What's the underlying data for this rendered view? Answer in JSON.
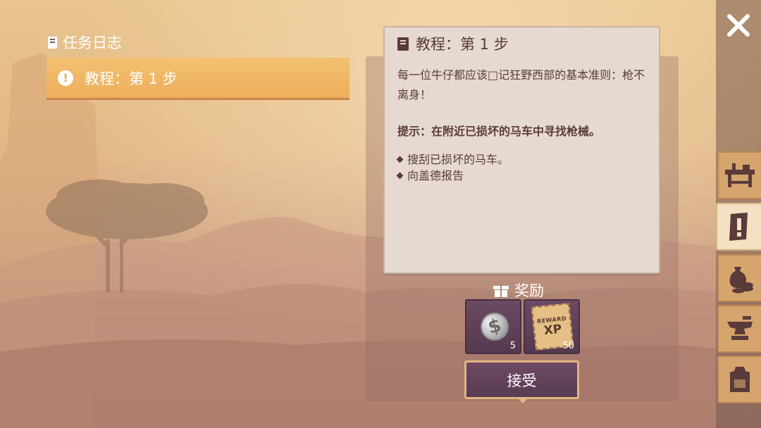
{
  "quest_log": {
    "title": "任务日志",
    "items": [
      {
        "label": "教程：第 1 步",
        "selected": true
      }
    ]
  },
  "detail": {
    "title": "教程：第 1 步",
    "description": "每一位牛仔都应该□记狂野西部的基本准则：枪不离身！",
    "hint": "提示：在附近已损坏的马车中寻找枪械。",
    "objectives": [
      "搜刮已损坏的马车。",
      "向盖德报告"
    ]
  },
  "rewards": {
    "label": "奖励",
    "items": [
      {
        "icon": "silver-coin-icon",
        "count": "5"
      },
      {
        "icon": "xp-reward-poster-icon",
        "count": "50",
        "poster_top": "REWARD",
        "poster_xp": "XP"
      }
    ]
  },
  "actions": {
    "accept_label": "接受"
  },
  "sidebar": {
    "close_icon": "close-icon",
    "tabs": [
      {
        "icon": "workbench-icon",
        "active": false
      },
      {
        "icon": "quest-scroll-icon",
        "active": true
      },
      {
        "icon": "money-bag-coins-icon",
        "active": false
      },
      {
        "icon": "anvil-icon",
        "active": false
      },
      {
        "icon": "backpack-icon",
        "active": false
      }
    ]
  },
  "colors": {
    "selected_quest": "#eeae5d",
    "card_background": "#e6d9cf",
    "card_text": "#5a3b3a",
    "reward_slot": "#5f4058",
    "active_tab": "#f4e1c3",
    "tab": "#d6a56e"
  }
}
